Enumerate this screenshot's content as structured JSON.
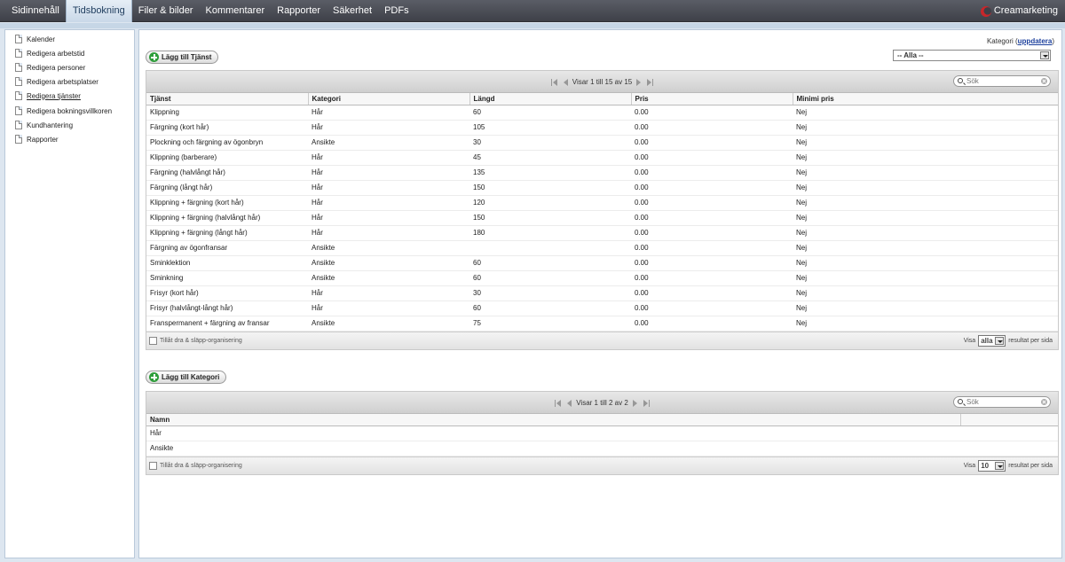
{
  "nav": {
    "tabs": [
      "Sidinnehåll",
      "Tidsbokning",
      "Filer & bilder",
      "Kommentarer",
      "Rapporter",
      "Säkerhet",
      "PDFs"
    ],
    "active_tab": "Tidsbokning",
    "brand": "Creamarketing"
  },
  "sidebar": {
    "items": [
      {
        "label": "Kalender"
      },
      {
        "label": "Redigera arbetstid"
      },
      {
        "label": "Redigera personer"
      },
      {
        "label": "Redigera arbetsplatser"
      },
      {
        "label": "Redigera tjänster",
        "active": true
      },
      {
        "label": "Redigera bokningsvillkoren"
      },
      {
        "label": "Kundhantering"
      },
      {
        "label": "Rapporter"
      }
    ]
  },
  "category_filter": {
    "label": "Kategori",
    "update_link": "uppdatera",
    "selected": "-- Alla --"
  },
  "services": {
    "add_button": "Lägg till Tjänst",
    "pager_text": "Visar 1 till 15 av 15",
    "search_placeholder": "Sök",
    "columns": [
      "Tjänst",
      "Kategori",
      "Längd",
      "Pris",
      "Minimi pris"
    ],
    "rows": [
      [
        "Klippning",
        "Hår",
        "60",
        "0.00",
        "Nej"
      ],
      [
        "Färgning (kort hår)",
        "Hår",
        "105",
        "0.00",
        "Nej"
      ],
      [
        "Plockning och färgning av ögonbryn",
        "Ansikte",
        "30",
        "0.00",
        "Nej"
      ],
      [
        "Klippning (barberare)",
        "Hår",
        "45",
        "0.00",
        "Nej"
      ],
      [
        "Färgning (halvlångt hår)",
        "Hår",
        "135",
        "0.00",
        "Nej"
      ],
      [
        "Färgning (långt hår)",
        "Hår",
        "150",
        "0.00",
        "Nej"
      ],
      [
        "Klippning + färgning (kort hår)",
        "Hår",
        "120",
        "0.00",
        "Nej"
      ],
      [
        "Klippning + färgning (halvlångt hår)",
        "Hår",
        "150",
        "0.00",
        "Nej"
      ],
      [
        "Klippning + färgning (långt hår)",
        "Hår",
        "180",
        "0.00",
        "Nej"
      ],
      [
        "Färgning av ögonfransar",
        "Ansikte",
        "",
        "0.00",
        "Nej"
      ],
      [
        "Sminklektion",
        "Ansikte",
        "60",
        "0.00",
        "Nej"
      ],
      [
        "Sminkning",
        "Ansikte",
        "60",
        "0.00",
        "Nej"
      ],
      [
        "Frisyr (kort hår)",
        "Hår",
        "30",
        "0.00",
        "Nej"
      ],
      [
        "Frisyr (halvlångt-långt hår)",
        "Hår",
        "60",
        "0.00",
        "Nej"
      ],
      [
        "Franspermanent + färgning av fransar",
        "Ansikte",
        "75",
        "0.00",
        "Nej"
      ]
    ],
    "drag_label": "Tillåt dra & släpp-organisering",
    "per_page_prefix": "Visa",
    "per_page_value": "alla",
    "per_page_suffix": "resultat per sida"
  },
  "categories": {
    "add_button": "Lägg till Kategori",
    "pager_text": "Visar 1 till 2 av 2",
    "search_placeholder": "Sök",
    "columns": [
      "Namn"
    ],
    "rows": [
      [
        "Hår"
      ],
      [
        "Ansikte"
      ]
    ],
    "drag_label": "Tillåt dra & släpp-organisering",
    "per_page_prefix": "Visa",
    "per_page_value": "10",
    "per_page_suffix": "resultat per sida"
  }
}
